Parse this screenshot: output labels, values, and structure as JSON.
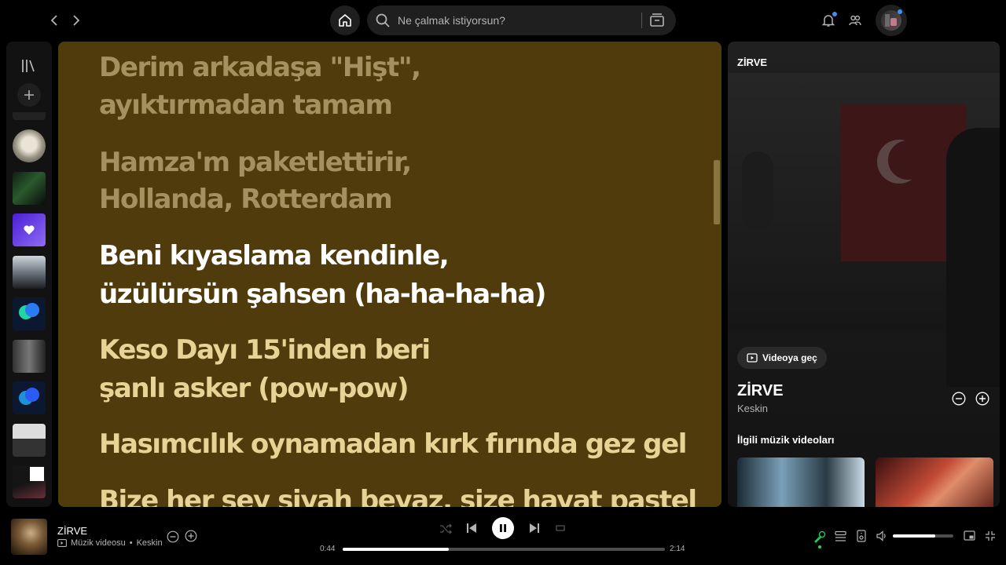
{
  "nav": {
    "search_placeholder": "Ne çalmak istiyorsun?"
  },
  "lyrics": {
    "lines": [
      {
        "text": "Derim arkadaşa \"Hişt\",",
        "state": "past"
      },
      {
        "text": "ayıktırmadan tamam",
        "state": "past"
      },
      {
        "text": "Hamza'm paketlettirir,",
        "state": "past"
      },
      {
        "text": "Hollanda, Rotterdam",
        "state": "past"
      },
      {
        "text": "Beni kıyaslama kendinle,",
        "state": "current"
      },
      {
        "text": "üzülürsün şahsen (ha-ha-ha-ha)",
        "state": "current"
      },
      {
        "text": "Keso Dayı 15'inden beri",
        "state": "future"
      },
      {
        "text": "şanlı asker (pow-pow)",
        "state": "future"
      },
      {
        "text": "Hasımcılık oynamadan kırk fırında gez gel",
        "state": "future"
      },
      {
        "text": "Bize her şey siyah beyaz, size hayat pastel",
        "state": "future"
      }
    ]
  },
  "right_panel": {
    "header": "ZİRVE",
    "switch_video": "Videoya geç",
    "track_title": "ZİRVE",
    "artist": "Keskin",
    "related_heading": "İlgili müzik videoları"
  },
  "now_playing": {
    "title": "ZİRVE",
    "type_label": "Müzik videosu",
    "separator": "•",
    "artist": "Keskin",
    "elapsed": "0:44",
    "duration": "2:14",
    "progress": 0.33,
    "volume": 0.7
  },
  "colors": {
    "lyrics_bg": "#4f3b0c",
    "lyric_past": "#a4915f",
    "lyric_current": "#ffffff",
    "lyric_future": "#e8d397",
    "accent_green": "#1ed760",
    "notification_dot": "#3d91f4"
  }
}
